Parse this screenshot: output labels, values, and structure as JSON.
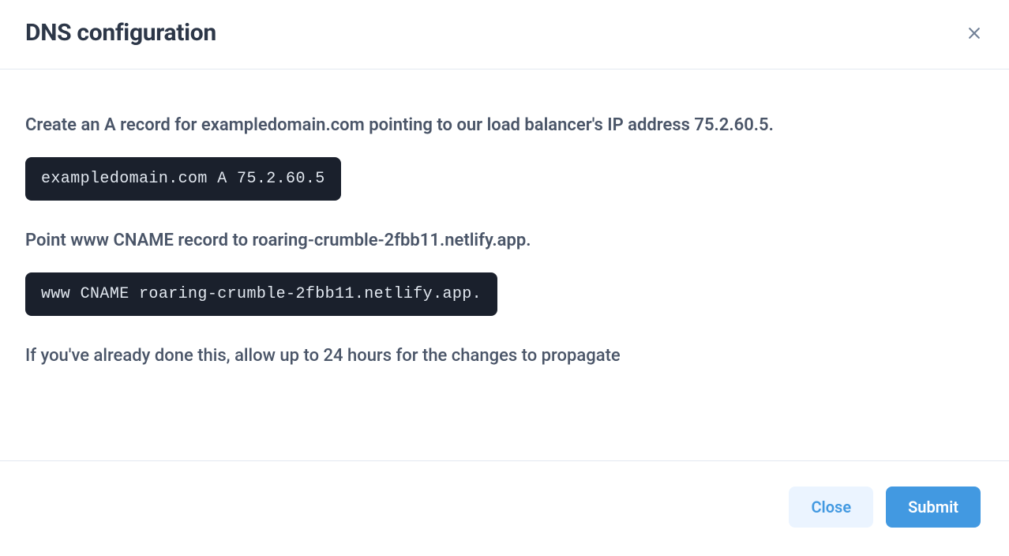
{
  "header": {
    "title": "DNS configuration"
  },
  "body": {
    "instruction_a_record": "Create an A record for exampledomain.com pointing to our load balancer's IP address 75.2.60.5.",
    "code_a_record": "exampledomain.com A 75.2.60.5",
    "instruction_cname": "Point www CNAME record to roaring-crumble-2fbb11.netlify.app.",
    "code_cname": "www CNAME roaring-crumble-2fbb11.netlify.app.",
    "note": "If you've already done this, allow up to 24 hours for the changes to propagate"
  },
  "footer": {
    "close_label": "Close",
    "submit_label": "Submit"
  }
}
